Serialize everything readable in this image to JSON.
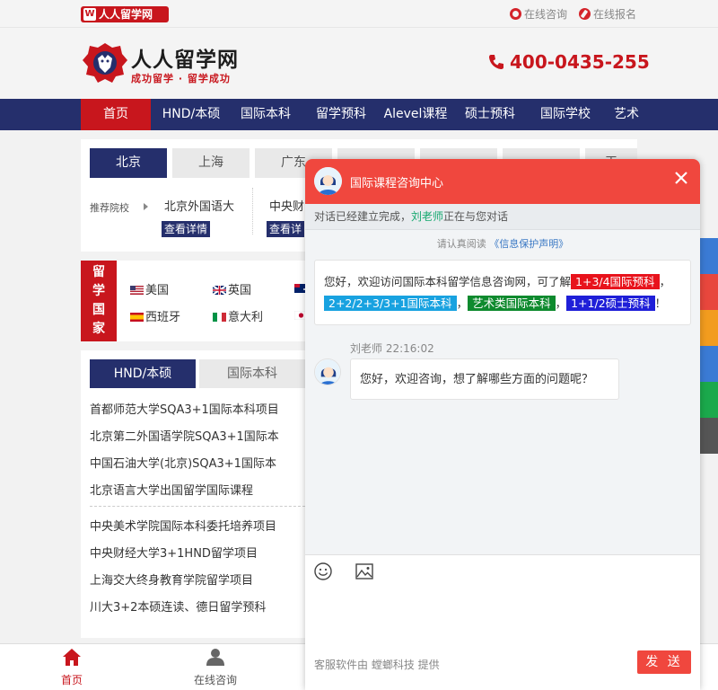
{
  "topbar": {
    "badge": "人人留学网",
    "badge_icon": "W",
    "online_consult": "在线咨询",
    "online_signup": "在线报名"
  },
  "header": {
    "logo_title": "人人留学网",
    "logo_sub": "成功留学 · 留学成功",
    "hotline": "400-0435-255"
  },
  "nav": {
    "items": [
      "首页",
      "HND/本硕",
      "国际本科",
      "留学预科",
      "Alevel课程",
      "硕士预科",
      "国际学校",
      "艺术"
    ]
  },
  "city_tabs": {
    "items": [
      "北京",
      "上海",
      "广东",
      "",
      "",
      "",
      "天"
    ],
    "rec_label": "推荐院校",
    "schools": [
      "北京外国语大",
      "中央财"
    ],
    "detail_btn": "查看详情",
    "detail_btn2": "查看详"
  },
  "countries": {
    "tag": [
      "留",
      "学",
      "国",
      "家"
    ],
    "items": [
      "美国",
      "英国",
      "西班牙",
      "意大利"
    ]
  },
  "programs": {
    "tabs": [
      "HND/本硕",
      "国际本科"
    ],
    "list_a": [
      "首都师范大学SQA3+1国际本科项目",
      "北京第二外国语学院SQA3+1国际本",
      "中国石油大学(北京)SQA3+1国际本",
      "北京语言大学出国留学国际课程"
    ],
    "list_b": [
      "中央美术学院国际本科委托培养项目",
      "中央财经大学3+1HND留学项目",
      "上海交大终身教育学院留学项目",
      "川大3+2本硕连读、德日留学预科"
    ]
  },
  "bottombar": {
    "items": [
      "首页",
      "在线咨询",
      "",
      "",
      ""
    ]
  },
  "chat": {
    "title": "国际课程咨询中心",
    "status_prefix": "对话已经建立完成，",
    "agent": "刘老师",
    "status_suffix": "正在与您对话",
    "privacy_prefix": "请认真阅读",
    "privacy_link": "《信息保护声明》",
    "welcome_text": "您好，欢迎访问国际本科留学信息咨询网，可了解",
    "tags": [
      "1+3/4国际预科",
      "2+2/2+3/3+1国际本科",
      "艺术类国际本科",
      "1+1/2硕士预科"
    ],
    "sep": "，",
    "end": "！",
    "msg_meta": "刘老师 22:16:02",
    "msg_text": "您好，欢迎咨询，想了解哪些方面的问题呢？",
    "powered": "客服软件由 螳螂科技 提供",
    "send": "发 送"
  },
  "colors": {
    "brand_red": "#c8161d",
    "nav_blue": "#252f6c",
    "chat_red": "#f0473e"
  }
}
